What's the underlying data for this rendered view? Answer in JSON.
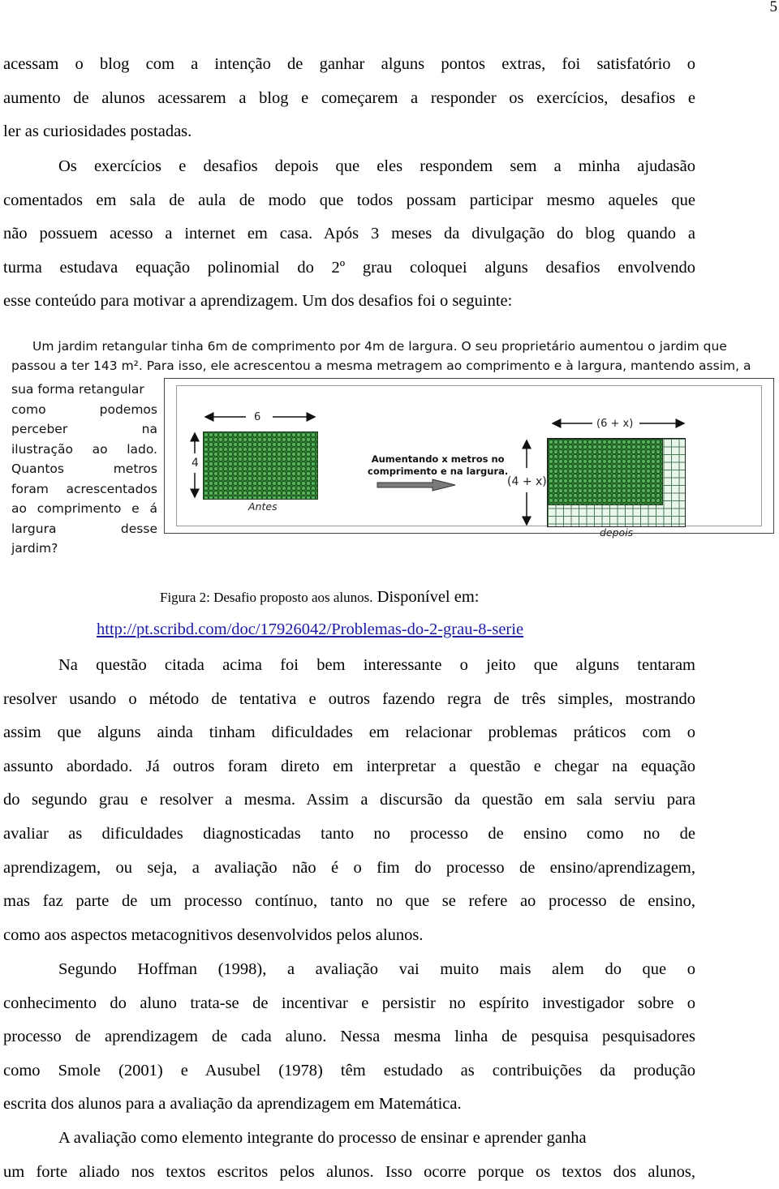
{
  "page": {
    "number": "5"
  },
  "paragraph1": {
    "lines": [
      "acessam o blog com a intenção de ganhar alguns pontos extras, foi satisfatório o",
      "aumento de alunos acessarem a blog e começarem a responder os exercícios, desafios e",
      "ler as curiosidades postadas."
    ]
  },
  "paragraph2": {
    "lines": [
      "Os exercícios e desafios depois que eles respondem sem a minha ajudasão",
      "comentados em sala de aula de modo que todos possam participar mesmo aqueles que",
      "não possuem acesso a internet em  casa. Após 3 meses da divulgação do blog quando a",
      "turma estudava equação polinomial  do 2º grau coloquei alguns desafios envolvendo",
      "esse conteúdo para motivar a  aprendizagem. Um dos desafios foi o seguinte:"
    ]
  },
  "figure": {
    "problem_line1": "Um jardim retangular tinha 6m de comprimento por 4m de largura. O seu proprietário aumentou o jardim que",
    "problem_line2": "passou a ter 143 m². Para isso, ele acrescentou a mesma metragem ao comprimento e à largura, mantendo assim, a",
    "side_lines": [
      "sua forma retangular",
      "como podemos",
      "perceber na",
      "ilustração ao lado.",
      "Quantos metros",
      "foram acrescentados",
      "ao comprimento e á",
      "largura desse",
      "jardim?"
    ],
    "before": {
      "width_label": "6",
      "height_label": "4",
      "caption": "Antes"
    },
    "transition": {
      "label_line1": "Aumentando x metros no",
      "label_line2": "comprimento e na largura."
    },
    "after": {
      "width_label": "(6 + x)",
      "height_label": "(4 + x)",
      "caption": "depois"
    },
    "colors": {
      "garden": "#2f7d32",
      "extension": "#eaf6ec",
      "arrow": "#777777"
    }
  },
  "caption": {
    "text": "Figura 2: Desafio proposto aos alunos.",
    "available": " Disponível em:",
    "link": "http://pt.scribd.com/doc/17926042/Problemas-do-2-grau-8-serie"
  },
  "paragraph3": {
    "lines": [
      "Na questão citada acima foi bem interessante o jeito que alguns tentaram",
      "resolver usando o método de tentativa e outros fazendo regra de três simples, mostrando",
      "assim que alguns ainda tinham dificuldades em relacionar problemas práticos com o",
      "assunto abordado. Já outros foram direto em interpretar a questão e chegar  na equação",
      "do segundo grau e resolver a mesma.  Assim a discursão da questão em sala serviu para",
      "avaliar as dificuldades diagnosticadas tanto no processo de ensino como no de",
      "aprendizagem, ou seja, a avaliação não é o fim do processo de ensino/aprendizagem,",
      "mas faz parte de um processo contínuo, tanto no que se refere ao processo de ensino,",
      "como aos aspectos metacognitivos desenvolvidos pelos alunos."
    ]
  },
  "paragraph4": {
    "lines": [
      "Segundo Hoffman (1998), a avaliação vai muito mais alem do que o",
      "conhecimento do aluno trata-se de incentivar e persistir no espírito investigador sobre o",
      "processo de aprendizagem de cada aluno. Nessa mesma linha de pesquisa pesquisadores",
      "como Smole (2001) e Ausubel (1978) têm estudado as contribuições da produção",
      "escrita dos alunos para a avaliação da aprendizagem em Matemática."
    ]
  },
  "paragraph5": {
    "lines": [
      "A avaliação como elemento integrante do processo de ensinar e aprender ganha",
      "um forte aliado nos textos escritos pelos alunos. Isso ocorre porque os textos dos alunos,"
    ]
  }
}
